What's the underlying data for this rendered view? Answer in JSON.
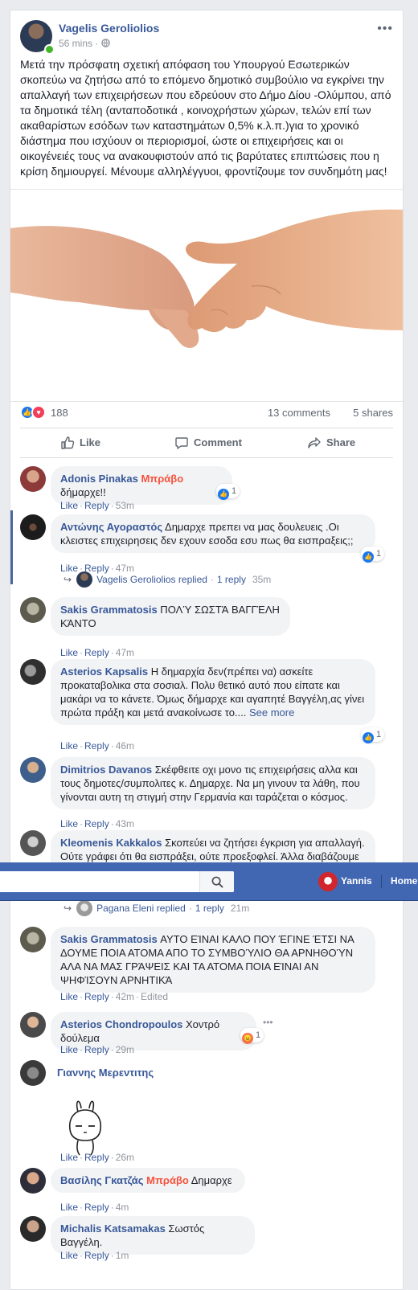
{
  "post": {
    "author": "Vagelis Geroliolios",
    "time": "56 mins",
    "separator": "·",
    "more_label": "•••",
    "text": "Μετά την πρόσφατη σχετική απόφαση του Υπουργού Εσωτερικών σκοπεύω να ζητήσω από το επόμενο δημοτικό συμβούλιο να εγκρίνει την απαλλαγή των επιχειρήσεων που εδρεύουν στο Δήμο Δίου -Ολύμπου, από τα δημοτικά τέλη (ανταποδοτικά , κοινοχρήστων χώρων, τελών επί των ακαθαρίστων εσόδων των καταστημάτων 0,5% κ.λ.π.)για το χρονικό διάστημα που ισχύουν οι περιορισμοί, ώστε οι επιχειρήσεις και οι οικογένειές τους να ανακουφιστούν από τις βαρύτατες επιπτώσεις που η κρίση δημιουργεί. Μένουμε αλληλέγγυοι, φροντίζουμε τον συνδημότη μας!",
    "reactions_count": "188",
    "comments_count": "13 comments",
    "shares_count": "5 shares"
  },
  "actions": {
    "like": "Like",
    "comment": "Comment",
    "share": "Share"
  },
  "comment_actions": {
    "like": "Like",
    "reply": "Reply",
    "dot": "·"
  },
  "comments": [
    {
      "name": "Adonis Pinakas",
      "bravo": "Μπράβο",
      "text": " δήμαρχε!!",
      "time": "53m",
      "reactions": "1"
    },
    {
      "name": "Αντώνης Αγοραστός",
      "text": " Δημαρχε πρεπει να μας δουλευεις .Οι κλειστες επιχειρησεις δεν εχουν εσοδα εσυ πως θα εισπραξεις;;",
      "time": "47m",
      "reactions": "1"
    },
    {
      "name": "Sakis Grammatosis",
      "text": " ΠΟΛΎ ΣΩΣΤΆ ΒΑΓΓΈΛΗ ΚΆΝΤΟ",
      "time": "47m"
    },
    {
      "name": "Asterios Kapsalis",
      "text": " Η δημαρχία δεν(πρέπει να) ασκείτε προκαταβολικα στα σοσιαλ. Πολυ θετικό αυτό που είπατε και μακάρι να το κάνετε. Όμως δήμαρχε και αγαπητέ Βαγγέλη,ας γίνει πρώτα πράξη και μετά ανακοίνωσε το.... ",
      "see_more": "See more",
      "time": "46m",
      "reactions": "1"
    },
    {
      "name": "Dimitrios Davanos",
      "text": " Σκέφθειτε οχι μονο τις επιχειρήσεις αλλα και τους δημοτες/συμπολιτες κ. Δημαρχε. Να μη γινουν τα λάθη, που γίνονται αυτη τη στιγμή στην Γερμανία και ταράζεται ο κόσμος.",
      "time": "43m"
    },
    {
      "name": "Kleomenis Kakkalos",
      "text": " Σκοπεύει να ζητήσει έγκριση για απαλλαγή. Ούτε γράφει ότι θα εισπράξει, ούτε προεξοφλεί. Άλλα διαβάζουμε οι"
    },
    {
      "name": "Sakis Grammatosis",
      "text": " ΑΥΤΟ ΕΊΝΑΙ ΚΑΛΟ ΠΟΥ ΈΓΙΝΕ ΈΤΣΙ ΝΑ ΔΟΥΜΕ ΠΟΙΑ ΑΤΟΜΑ ΑΠΟ ΤΟ ΣΥΜΒΟΎΛΙΟ ΘΑ ΑΡΝΗΘΟΎΝ ΑΛΑ ΝΑ ΜΑΣ ΓΡΆΨΕΙΣ ΚΑΙ ΤΑ ΑΤΟΜΑ ΠΟΙΑ ΕΊΝΑΙ ΑΝ ΨΗΦΊΣΟΥΝ ΑΡΝΗΤΙΚΆ",
      "time": "42m",
      "edited": "Edited"
    },
    {
      "name": "Asterios Chondropoulos",
      "text": " Χοντρό δούλεμα",
      "time": "29m",
      "reactions": "1",
      "more": "•••"
    },
    {
      "name": "Γιαννης Μερεντιτης",
      "time": "26m"
    },
    {
      "name": "Βασίλης Γκατζάς",
      "bravo": "Μπράβο",
      "text": " Δημαρχε",
      "time": "4m"
    },
    {
      "name": "Michalis Katsamakas",
      "text": " Σωστός Βαγγέλη.",
      "time": "1m"
    }
  ],
  "replies": [
    {
      "name": "Vagelis Geroliolios",
      "replied": " replied",
      "count": "1 reply",
      "time": "35m"
    },
    {
      "name": "Pagana Eleni",
      "replied": " replied",
      "count": "1 reply",
      "time": "21m"
    }
  ],
  "navbar": {
    "user": "Yannis",
    "home": "Home"
  },
  "colors": {
    "link": "#385898",
    "bravo": "#f5533d",
    "facebook_blue": "#4267b2"
  }
}
